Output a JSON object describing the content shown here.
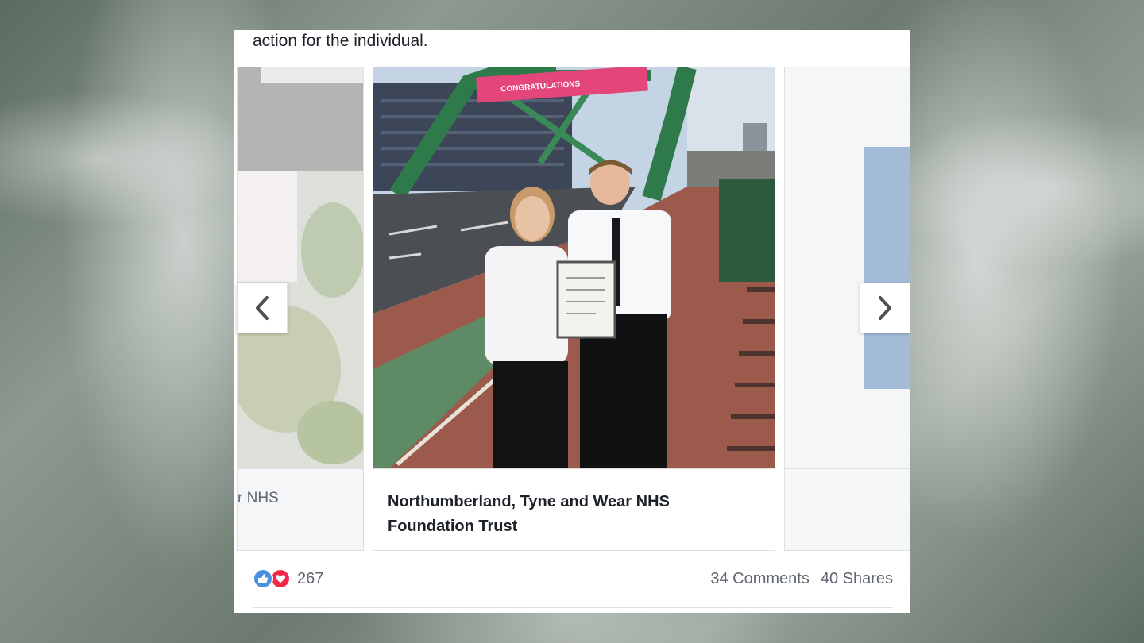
{
  "post": {
    "text": "action for the individual."
  },
  "carousel": {
    "prev_card_caption": "r NHS",
    "main_card_caption": "Northumberland, Tyne and Wear NHS Foundation Trust",
    "banner_text": "CONGRATULATIONS",
    "prev_icon": "chevron-left-icon",
    "next_icon": "chevron-right-icon"
  },
  "footer": {
    "reaction_count": "267",
    "comments": "34 Comments",
    "shares": "40 Shares"
  },
  "colors": {
    "like": "#4a90e2",
    "love": "#f0284a",
    "text": "#1d2129",
    "muted": "#606770"
  }
}
